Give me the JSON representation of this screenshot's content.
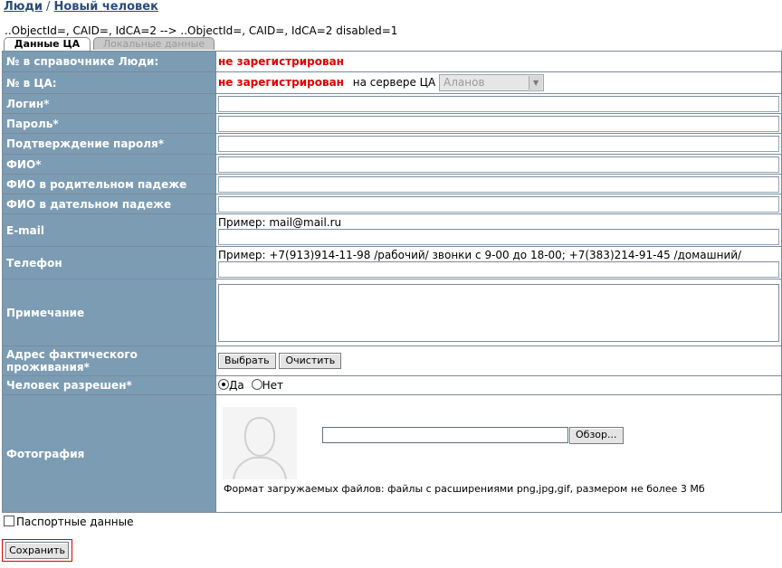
{
  "breadcrumb": {
    "root": "Люди",
    "separator": "/",
    "current": "Новый человек"
  },
  "debug_line": "..ObjectId=, CAID=, IdCA=2 --> ..ObjectId=, CAID=, IdCA=2 disabled=1",
  "tabs": [
    {
      "label": "Данные ЦА",
      "active": true
    },
    {
      "label": "Локальные данные",
      "active": false
    }
  ],
  "form": {
    "registry_no": {
      "label": "№ в справочнике Люди:",
      "value": "не зарегистрирован"
    },
    "ca_no": {
      "label": "№ в ЦА:",
      "value": "не зарегистрирован",
      "server_label": "на сервере ЦА",
      "server_value": "Аланов"
    },
    "login": {
      "label": "Логин*",
      "value": ""
    },
    "password": {
      "label": "Пароль*",
      "value": ""
    },
    "password_confirm": {
      "label": "Подтверждение пароля*",
      "value": ""
    },
    "fio": {
      "label": "ФИО*",
      "value": ""
    },
    "fio_genitive": {
      "label": "ФИО в родительном падеже",
      "value": ""
    },
    "fio_dative": {
      "label": "ФИО в дательном падеже",
      "value": ""
    },
    "email": {
      "label": "E-mail",
      "hint": "Пример: mail@mail.ru",
      "value": ""
    },
    "phone": {
      "label": "Телефон",
      "hint": "Пример: +7(913)914-11-98 /рабочий/ звонки с 9-00 до 18-00; +7(383)214-91-45 /домашний/",
      "value": ""
    },
    "note": {
      "label": "Примечание",
      "value": ""
    },
    "address": {
      "label": "Адрес фактического проживания*",
      "select_button": "Выбрать",
      "clear_button": "Очистить"
    },
    "allowed": {
      "label": "Человек разрешен*",
      "yes": "Да",
      "no": "Нет",
      "selected": "Да"
    },
    "photo": {
      "label": "Фотография",
      "browse_button": "Обзор...",
      "format_note": "Формат загружаемых файлов: файлы с расширениями png,jpg,gif, размером не более 3 Мб"
    }
  },
  "passport_label": "Паспортные данные",
  "save_button": "Сохранить",
  "colors": {
    "label_bg": "#7c9cb4",
    "link": "#2a4d7a",
    "status_red": "#e00000"
  }
}
